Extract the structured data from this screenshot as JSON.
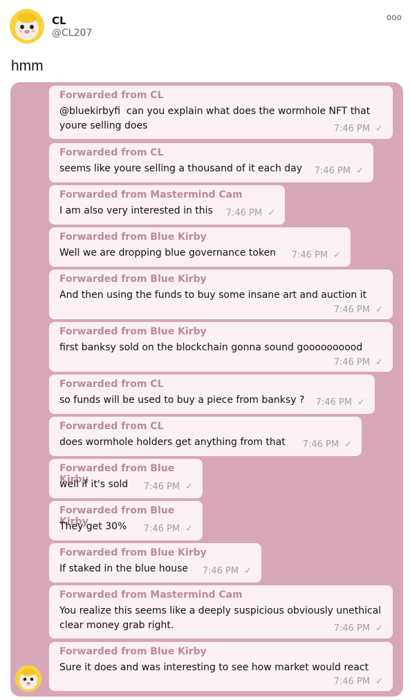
{
  "tweet": {
    "author_name": "CL",
    "author_handle": "@CL207",
    "text": "hmm",
    "more_icon": "ooo"
  },
  "chat": {
    "messages": [
      {
        "from": "Forwarded from CL",
        "text": "@bluekirbyfi  can you explain what does the wormhole NFT that\nyoure selling does",
        "time": "7:46 PM"
      },
      {
        "from": "Forwarded from CL",
        "text": "seems like youre selling a thousand of it each day",
        "time": "7:46 PM"
      },
      {
        "from": "Forwarded from Mastermind Cam",
        "text": "I am also very interested in this",
        "time": "7:46 PM"
      },
      {
        "from": "Forwarded from Blue Kirby",
        "text": "Well we are dropping blue governance token",
        "time": "7:46 PM"
      },
      {
        "from": "Forwarded from Blue Kirby",
        "text": "And then using the funds to buy some insane art and auction it",
        "time": "7:46 PM"
      },
      {
        "from": "Forwarded from Blue Kirby",
        "text": "first banksy sold on the blockchain gonna sound goooooooood",
        "time": "7:46 PM"
      },
      {
        "from": "Forwarded from CL",
        "text": "so funds will be used to buy a piece from banksy ?",
        "time": "7:46 PM"
      },
      {
        "from": "Forwarded from CL",
        "text": "does wormhole holders get anything from that",
        "time": "7:46 PM"
      },
      {
        "from": "Forwarded from Blue Kirby",
        "text": "well if it's sold",
        "time": "7:46 PM"
      },
      {
        "from": "Forwarded from Blue Kirby",
        "text": "They get 30%",
        "time": "7:46 PM"
      },
      {
        "from": "Forwarded from Blue Kirby",
        "text": "If staked in the blue house",
        "time": "7:46 PM"
      },
      {
        "from": "Forwarded from Mastermind Cam",
        "text": "You realize this seems like a deeply suspicious obviously unethical\nclear money grab right.",
        "time": "7:46 PM"
      },
      {
        "from": "Forwarded from Blue Kirby",
        "text": "Sure it does and was interesting to see how market would react",
        "time": "7:46 PM"
      }
    ]
  },
  "colors": {
    "chat_background": "#d7a7b8",
    "bubble_background": "#fbf0f3",
    "forward_label": "#b98a9a"
  }
}
